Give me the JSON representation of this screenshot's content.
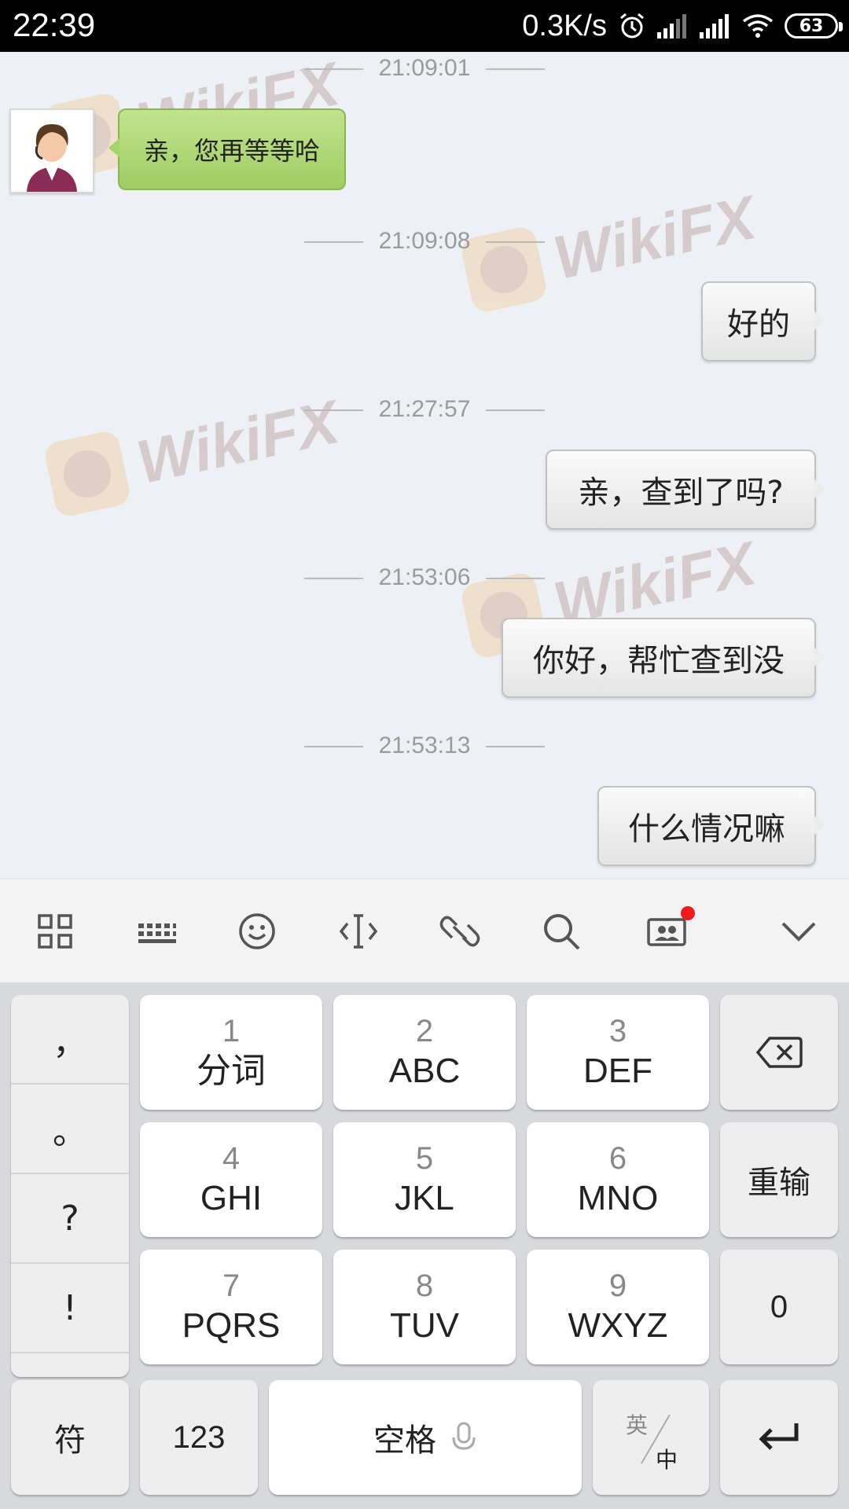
{
  "status_bar": {
    "time": "22:39",
    "net_speed": "0.3K/s",
    "battery": "63",
    "icons": [
      "alarm-icon",
      "signal-icon",
      "signal-icon",
      "wifi-icon",
      "battery-icon"
    ]
  },
  "watermark": "WikiFX",
  "messages": [
    {
      "time": "21:09:01",
      "sender": "agent",
      "text": "亲，您再等等哈"
    },
    {
      "time": "21:09:08",
      "sender": "me",
      "text": "好的"
    },
    {
      "time": "21:27:57",
      "sender": "me",
      "text": "亲，查到了吗?"
    },
    {
      "time": "21:53:06",
      "sender": "me",
      "text": "你好，帮忙查到没"
    },
    {
      "time": "21:53:13",
      "sender": "me",
      "text": "什么情况嘛"
    }
  ],
  "toolbar": {
    "icons": [
      "grid-icon",
      "keyboard-icon",
      "emoji-icon",
      "cursor-icon",
      "link-icon",
      "search-icon",
      "contact-card-icon",
      "collapse-chevron-icon"
    ],
    "notification_color": "#f01c1c"
  },
  "keyboard": {
    "punctuation": [
      "，",
      "。",
      "?",
      "!"
    ],
    "keys": [
      {
        "num": "1",
        "letters": "分词"
      },
      {
        "num": "2",
        "letters": "ABC"
      },
      {
        "num": "3",
        "letters": "DEF"
      },
      {
        "num": "4",
        "letters": "GHI"
      },
      {
        "num": "5",
        "letters": "JKL"
      },
      {
        "num": "6",
        "letters": "MNO"
      },
      {
        "num": "7",
        "letters": "PQRS"
      },
      {
        "num": "8",
        "letters": "TUV"
      },
      {
        "num": "9",
        "letters": "WXYZ"
      }
    ],
    "retype": "重输",
    "zero": "0",
    "symbols": "符",
    "numbers": "123",
    "space": "空格",
    "lang_top": "英",
    "lang_bottom": "中"
  }
}
